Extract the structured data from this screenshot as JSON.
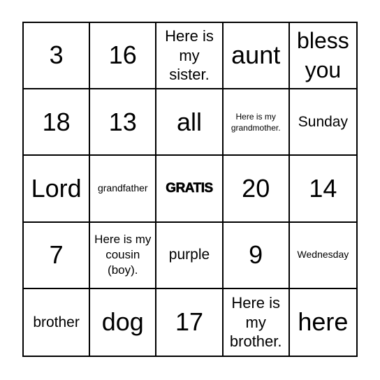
{
  "card": {
    "title": "",
    "cells": [
      {
        "text": "3",
        "size": "s-xl"
      },
      {
        "text": "16",
        "size": "s-xl"
      },
      {
        "text": "Here is my sister.",
        "size": "s-m"
      },
      {
        "text": "aunt",
        "size": "s-xl"
      },
      {
        "text": "bless you",
        "size": "s-l"
      },
      {
        "text": "18",
        "size": "s-xl"
      },
      {
        "text": "13",
        "size": "s-xl"
      },
      {
        "text": "all",
        "size": "s-xl"
      },
      {
        "text": "Here is my grandmother.",
        "size": "s-xs"
      },
      {
        "text": "Sunday",
        "size": "s-ms"
      },
      {
        "text": "Lord",
        "size": "s-xl"
      },
      {
        "text": "grandfather",
        "size": "s-xxs"
      },
      {
        "text": "GRATIS",
        "size": "s-free",
        "free": true
      },
      {
        "text": "20",
        "size": "s-xl"
      },
      {
        "text": "14",
        "size": "s-xl"
      },
      {
        "text": "7",
        "size": "s-xl"
      },
      {
        "text": "Here is my cousin (boy).",
        "size": "s-s"
      },
      {
        "text": "purple",
        "size": "s-ms"
      },
      {
        "text": "9",
        "size": "s-xl"
      },
      {
        "text": "Wednesday",
        "size": "s-xxs"
      },
      {
        "text": "brother",
        "size": "s-ms"
      },
      {
        "text": "dog",
        "size": "s-xl"
      },
      {
        "text": "17",
        "size": "s-xl"
      },
      {
        "text": "Here is my brother.",
        "size": "s-m"
      },
      {
        "text": "here",
        "size": "s-xl"
      }
    ]
  }
}
